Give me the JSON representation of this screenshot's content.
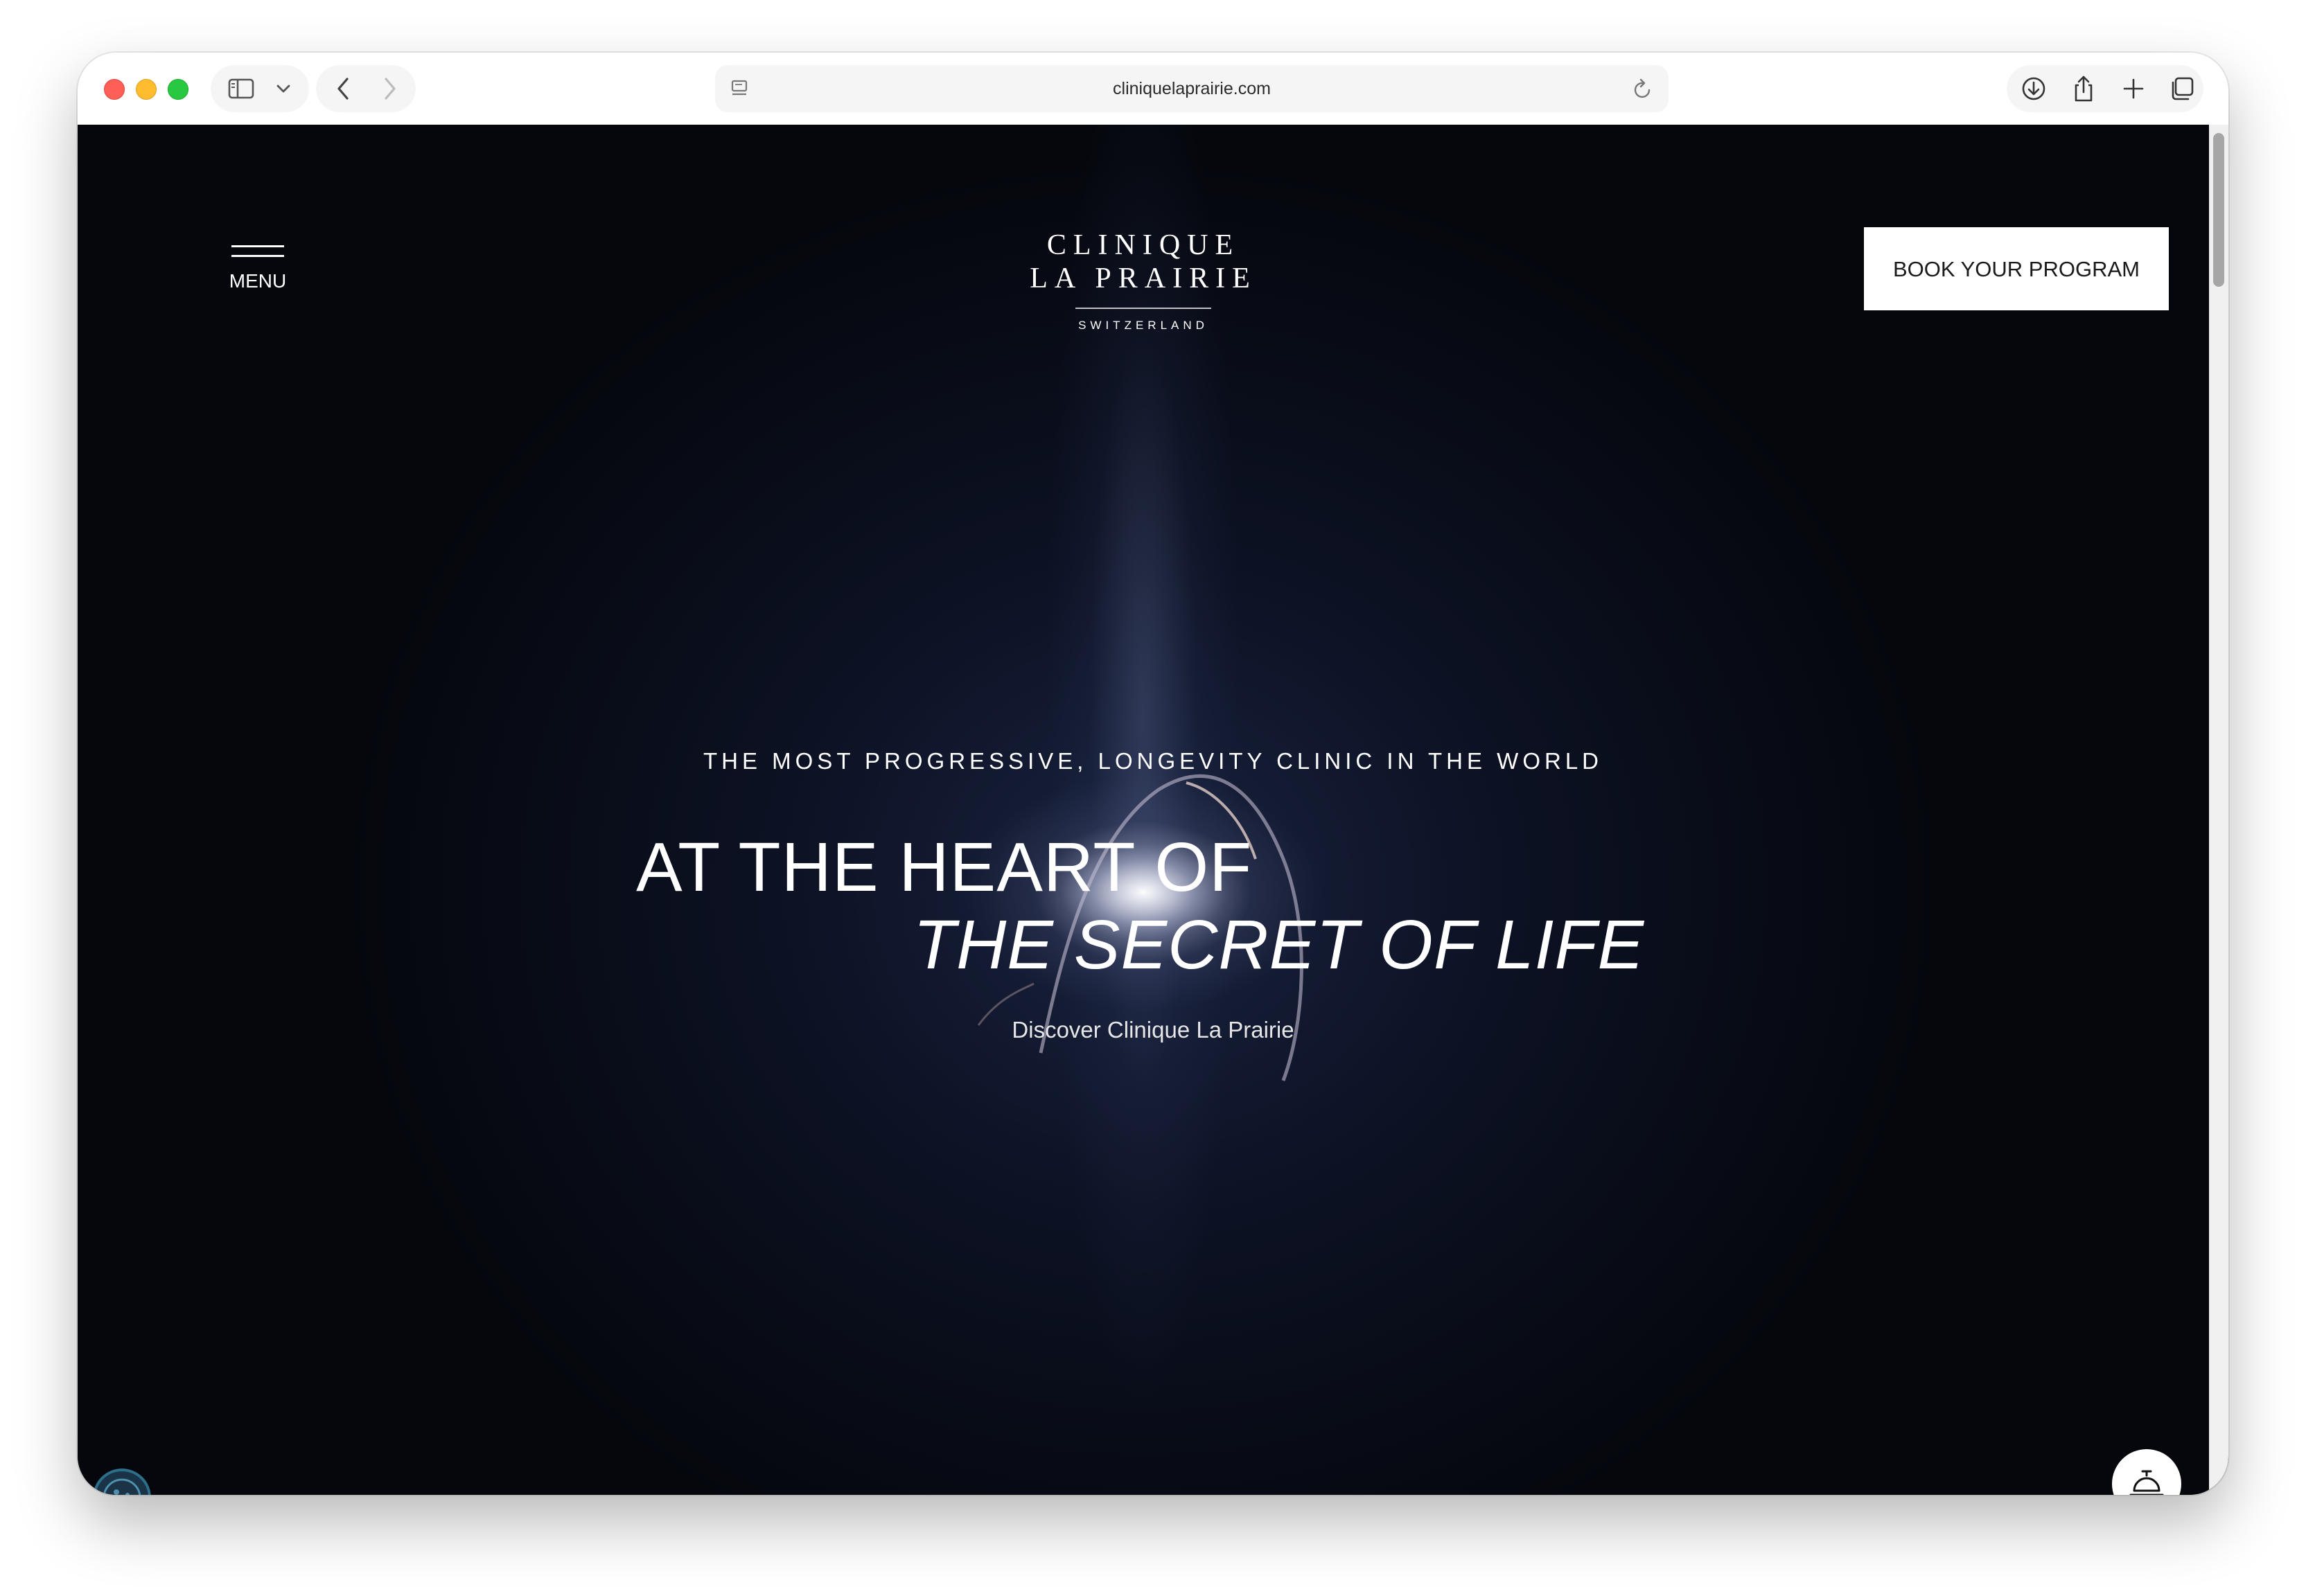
{
  "browser": {
    "url": "cliniquelaprairie.com",
    "icons": {
      "sidebar": "sidebar-icon",
      "chevron": "chevron-down-icon",
      "back": "back-arrow-icon",
      "forward": "forward-arrow-icon",
      "site": "site-icon",
      "reload": "reload-icon",
      "download": "download-icon",
      "share": "share-icon",
      "new_tab": "plus-icon",
      "tabs": "tab-overview-icon"
    }
  },
  "header": {
    "menu_label": "MENU",
    "logo": {
      "line1": "CLINIQUE",
      "line2": "LA PRAIRIE",
      "line3": "SWITZERLAND"
    },
    "cta_label": "BOOK YOUR PROGRAM"
  },
  "hero": {
    "tagline": "THE MOST PROGRESSIVE, LONGEVITY CLINIC IN THE WORLD",
    "headline_line1": "AT THE HEART OF",
    "headline_line2": "THE SECRET OF LIFE",
    "link_label": "Discover Clinique La Prairie"
  },
  "floating": {
    "cookie_icon": "cookie-icon",
    "concierge_icon": "service-bell-icon"
  },
  "colors": {
    "background": "#05070d",
    "text": "#ffffff",
    "cta_background": "#ffffff",
    "cta_text": "#1a1a1a"
  }
}
